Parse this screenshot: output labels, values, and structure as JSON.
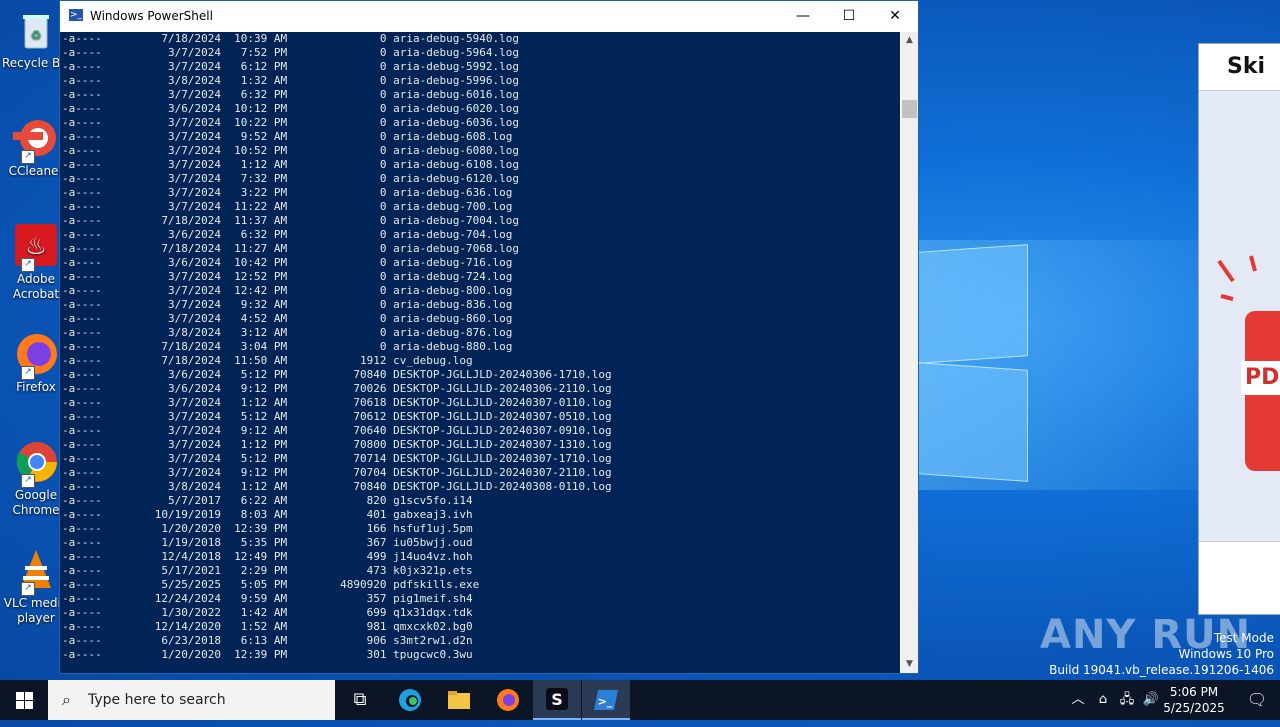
{
  "desktop": {
    "icons": [
      {
        "label1": "Recycle Bin",
        "label2": ""
      },
      {
        "label1": "CCleaner",
        "label2": ""
      },
      {
        "label1": "Adobe",
        "label2": "Acrobat"
      },
      {
        "label1": "Firefox",
        "label2": ""
      },
      {
        "label1": "Google",
        "label2": "Chrome"
      },
      {
        "label1": "VLC media",
        "label2": "player"
      }
    ]
  },
  "powershell": {
    "title": "Windows PowerShell",
    "controls": {
      "minimize": "—",
      "maximize": "☐",
      "close": "✕"
    },
    "lines": [
      "-a----         7/18/2024  10:39 AM              0 aria-debug-5940.log",
      "-a----          3/7/2024   7:52 PM              0 aria-debug-5964.log",
      "-a----          3/7/2024   6:12 PM              0 aria-debug-5992.log",
      "-a----          3/8/2024   1:32 AM              0 aria-debug-5996.log",
      "-a----          3/7/2024   6:32 PM              0 aria-debug-6016.log",
      "-a----          3/6/2024  10:12 PM              0 aria-debug-6020.log",
      "-a----          3/7/2024  10:22 PM              0 aria-debug-6036.log",
      "-a----          3/7/2024   9:52 AM              0 aria-debug-608.log",
      "-a----          3/7/2024  10:52 PM              0 aria-debug-6080.log",
      "-a----          3/7/2024   1:12 AM              0 aria-debug-6108.log",
      "-a----          3/7/2024   7:32 PM              0 aria-debug-6120.log",
      "-a----          3/7/2024   3:22 PM              0 aria-debug-636.log",
      "-a----          3/7/2024  11:22 AM              0 aria-debug-700.log",
      "-a----         7/18/2024  11:37 AM              0 aria-debug-7004.log",
      "-a----          3/6/2024   6:32 PM              0 aria-debug-704.log",
      "-a----         7/18/2024  11:27 AM              0 aria-debug-7068.log",
      "-a----          3/6/2024  10:42 PM              0 aria-debug-716.log",
      "-a----          3/7/2024  12:52 PM              0 aria-debug-724.log",
      "-a----          3/7/2024  12:42 PM              0 aria-debug-800.log",
      "-a----          3/7/2024   9:32 AM              0 aria-debug-836.log",
      "-a----          3/7/2024   4:52 AM              0 aria-debug-860.log",
      "-a----          3/8/2024   3:12 AM              0 aria-debug-876.log",
      "-a----         7/18/2024   3:04 PM              0 aria-debug-880.log",
      "-a----         7/18/2024  11:50 AM           1912 cv_debug.log",
      "-a----          3/6/2024   5:12 PM          70840 DESKTOP-JGLLJLD-20240306-1710.log",
      "-a----          3/6/2024   9:12 PM          70026 DESKTOP-JGLLJLD-20240306-2110.log",
      "-a----          3/7/2024   1:12 AM          70618 DESKTOP-JGLLJLD-20240307-0110.log",
      "-a----          3/7/2024   5:12 AM          70612 DESKTOP-JGLLJLD-20240307-0510.log",
      "-a----          3/7/2024   9:12 AM          70640 DESKTOP-JGLLJLD-20240307-0910.log",
      "-a----          3/7/2024   1:12 PM          70800 DESKTOP-JGLLJLD-20240307-1310.log",
      "-a----          3/7/2024   5:12 PM          70714 DESKTOP-JGLLJLD-20240307-1710.log",
      "-a----          3/7/2024   9:12 PM          70704 DESKTOP-JGLLJLD-20240307-2110.log",
      "-a----          3/8/2024   1:12 AM          70840 DESKTOP-JGLLJLD-20240308-0110.log",
      "-a----          5/7/2017   6:22 AM            820 g1scv5fo.i14",
      "-a----        10/19/2019   8:03 AM            401 gabxeaj3.ivh",
      "-a----         1/20/2020  12:39 PM            166 hsfuf1uj.5pm",
      "-a----         1/19/2018   5:35 PM            367 iu05bwjj.oud",
      "-a----         12/4/2018  12:49 PM            499 j14uo4vz.hoh",
      "-a----         5/17/2021   2:29 PM            473 k0jx321p.ets",
      "-a----         5/25/2025   5:05 PM        4890920 pdfskills.exe",
      "-a----        12/24/2024   9:59 AM            357 pig1meif.sh4",
      "-a----         1/30/2022   1:42 AM            699 q1x31dqx.tdk",
      "-a----        12/14/2020   1:52 AM            981 qmxcxk02.bg0",
      "-a----         6/23/2018   6:13 AM            906 s3mt2rw1.d2n",
      "-a----         1/20/2020  12:39 PM            301 tpugcwc0.3wu"
    ]
  },
  "skillshare_window": {
    "brand": "Ski",
    "badge": "PD"
  },
  "watermark": {
    "text": "ANY RUN",
    "mode": "Test Mode",
    "os": "Windows 10 Pro",
    "build": "Build 19041.vb_release.191206-1406"
  },
  "taskbar": {
    "search_placeholder": "Type here to search",
    "time": "5:06 PM",
    "date": "5/25/2025"
  },
  "colors": {
    "console_bg": "#012456",
    "taskbar_bg": "#0b1526",
    "desktop_bg": "#0a56b8"
  }
}
